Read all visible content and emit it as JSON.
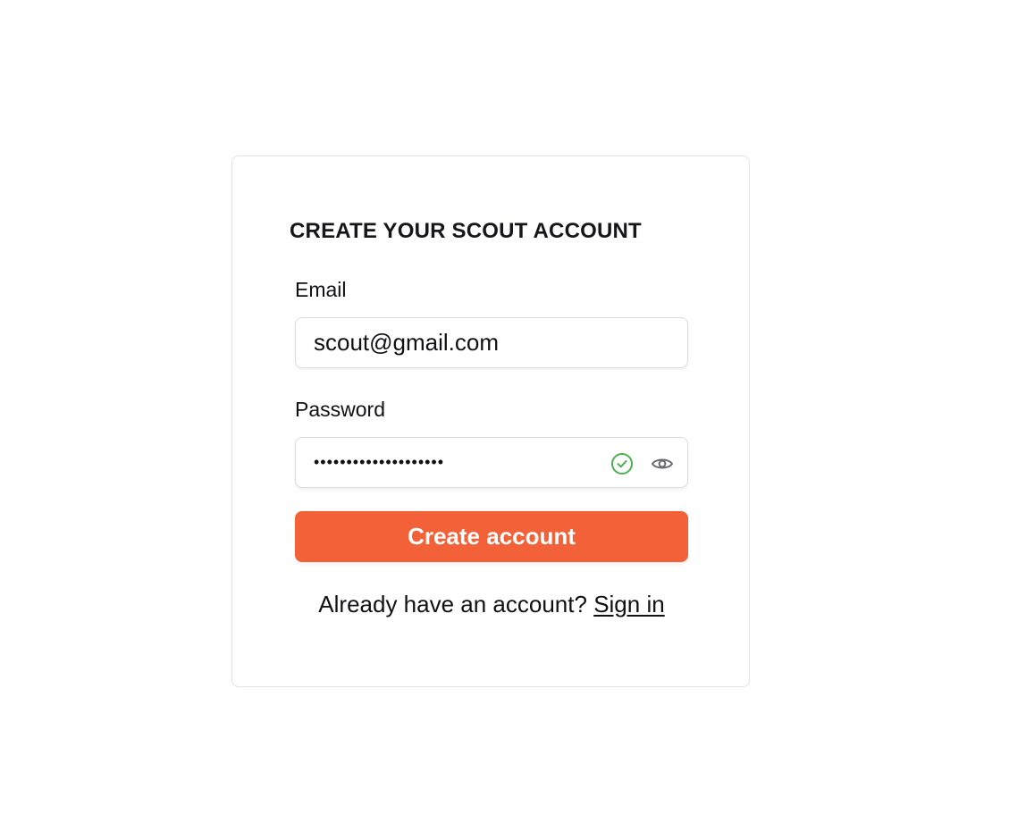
{
  "signup": {
    "title": "CREATE YOUR SCOUT ACCOUNT",
    "email": {
      "label": "Email",
      "value": "scout@gmail.com"
    },
    "password": {
      "label": "Password",
      "value": "••••••••••••••••••••",
      "valid_icon": "check-circle-icon",
      "valid_color": "#4caf50",
      "toggle_icon": "eye-icon"
    },
    "submit_label": "Create account",
    "submit_color": "#f26137",
    "footer": {
      "prompt": "Already have an account?",
      "link_label": "Sign in"
    }
  }
}
